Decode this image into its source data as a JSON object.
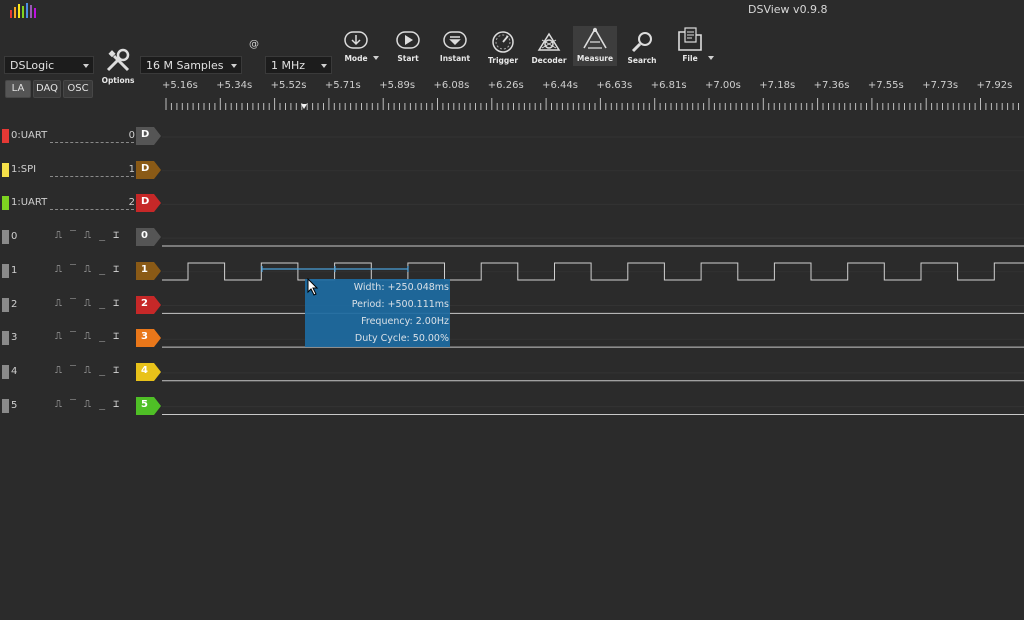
{
  "title_bar": {
    "app_title": "DSView v0.9.8"
  },
  "toolbar": {
    "device": "DSLogic",
    "options_label": "Options",
    "samples": "16 M Samples",
    "at": "@",
    "rate": "1 MHz",
    "buttons": [
      {
        "label": "Mode",
        "icon": "mode-icon"
      },
      {
        "label": "Start",
        "icon": "start-icon"
      },
      {
        "label": "Instant",
        "icon": "instant-icon"
      },
      {
        "label": "Trigger",
        "icon": "trigger-icon"
      },
      {
        "label": "Decoder",
        "icon": "decoder-icon"
      },
      {
        "label": "Measure",
        "icon": "measure-icon"
      },
      {
        "label": "Search",
        "icon": "search-icon"
      },
      {
        "label": "File",
        "icon": "file-icon"
      }
    ]
  },
  "modes": [
    {
      "label": "LA"
    },
    {
      "label": "DAQ"
    },
    {
      "label": "OSC"
    }
  ],
  "ruler": {
    "labels": [
      "+5.16s",
      "+5.34s",
      "+5.52s",
      "+5.71s",
      "+5.89s",
      "+6.08s",
      "+6.26s",
      "+6.44s",
      "+6.63s",
      "+6.81s",
      "+7.00s",
      "+7.18s",
      "+7.36s",
      "+7.55s",
      "+7.73s",
      "+7.92s"
    ]
  },
  "channels": [
    {
      "name": "0:UART",
      "index": "0",
      "tag": "D",
      "color": "#e53935",
      "tag_color": "#555555",
      "kind": "decoder"
    },
    {
      "name": "1:SPI",
      "index": "1",
      "tag": "D",
      "color": "#f5e04a",
      "tag_color": "#8a5a16",
      "kind": "decoder"
    },
    {
      "name": "1:UART",
      "index": "2",
      "tag": "D",
      "color": "#7ed321",
      "tag_color": "#c62828",
      "kind": "decoder"
    },
    {
      "name": "0",
      "tag": "0",
      "color": "#8a8a8a",
      "tag_color": "#555555",
      "kind": "logic",
      "triggers": "⎍ ‾ ⎍ _ ⌶"
    },
    {
      "name": "1",
      "tag": "1",
      "color": "#8a8a8a",
      "tag_color": "#8a5a16",
      "kind": "logic",
      "triggers": "⎍ ‾ ⎍ _ ⌶"
    },
    {
      "name": "2",
      "tag": "2",
      "color": "#8a8a8a",
      "tag_color": "#c62828",
      "kind": "logic",
      "triggers": "⎍ ‾ ⎍ _ ⌶"
    },
    {
      "name": "3",
      "tag": "3",
      "color": "#8a8a8a",
      "tag_color": "#e9771a",
      "kind": "logic",
      "triggers": "⎍ ‾ ⎍ _ ⌶"
    },
    {
      "name": "4",
      "tag": "4",
      "color": "#8a8a8a",
      "tag_color": "#e8c21a",
      "kind": "logic",
      "triggers": "⎍ ‾ ⎍ _ ⌶"
    },
    {
      "name": "5",
      "tag": "5",
      "color": "#8a8a8a",
      "tag_color": "#4fbf26",
      "kind": "logic",
      "triggers": "⎍ ‾ ⎍ _ ⌶"
    }
  ],
  "measure": {
    "width": "Width: +250.048ms",
    "period": "Period: +500.111ms",
    "frequency": "Frequency: 2.00Hz",
    "duty": "Duty Cycle: 50.00%"
  }
}
